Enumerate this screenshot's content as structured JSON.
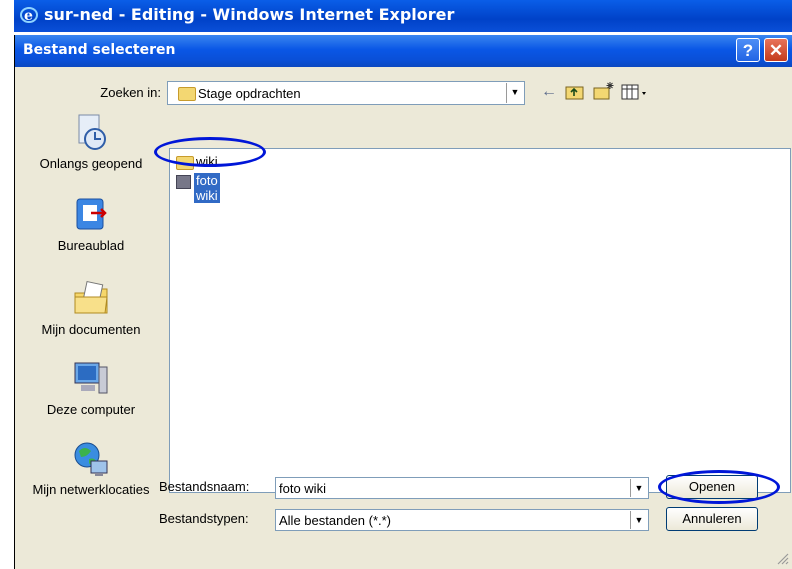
{
  "ie_window": {
    "title": "sur-ned - Editing - Windows Internet Explorer"
  },
  "dialog": {
    "title": "Bestand selecteren",
    "help_label": "?",
    "close_label": "✕",
    "look_in_label": "Zoeken in:",
    "look_in_value": "Stage opdrachten",
    "places": [
      {
        "label": "Onlangs geopend",
        "icon": "recent-clock-icon"
      },
      {
        "label": "Bureaublad",
        "icon": "desktop-icon"
      },
      {
        "label": "Mijn documenten",
        "icon": "my-documents-icon"
      },
      {
        "label": "Deze computer",
        "icon": "computer-icon"
      },
      {
        "label": "Mijn netwerklocaties",
        "icon": "network-globe-icon"
      }
    ],
    "files": [
      {
        "name": "wiki",
        "type": "folder",
        "selected": false
      },
      {
        "name": "foto wiki",
        "type": "image",
        "selected": true
      }
    ],
    "file_name_label": "Bestandsnaam:",
    "file_name_value": "foto wiki",
    "file_type_label": "Bestandstypen:",
    "file_type_value": "Alle bestanden (*.*)",
    "open_label": "Openen",
    "cancel_label": "Annuleren"
  },
  "colors": {
    "title_blue": "#0a4fd6",
    "annotation": "#0016d8",
    "selection": "#316ac5",
    "dialog_bg": "#ece9d8"
  }
}
